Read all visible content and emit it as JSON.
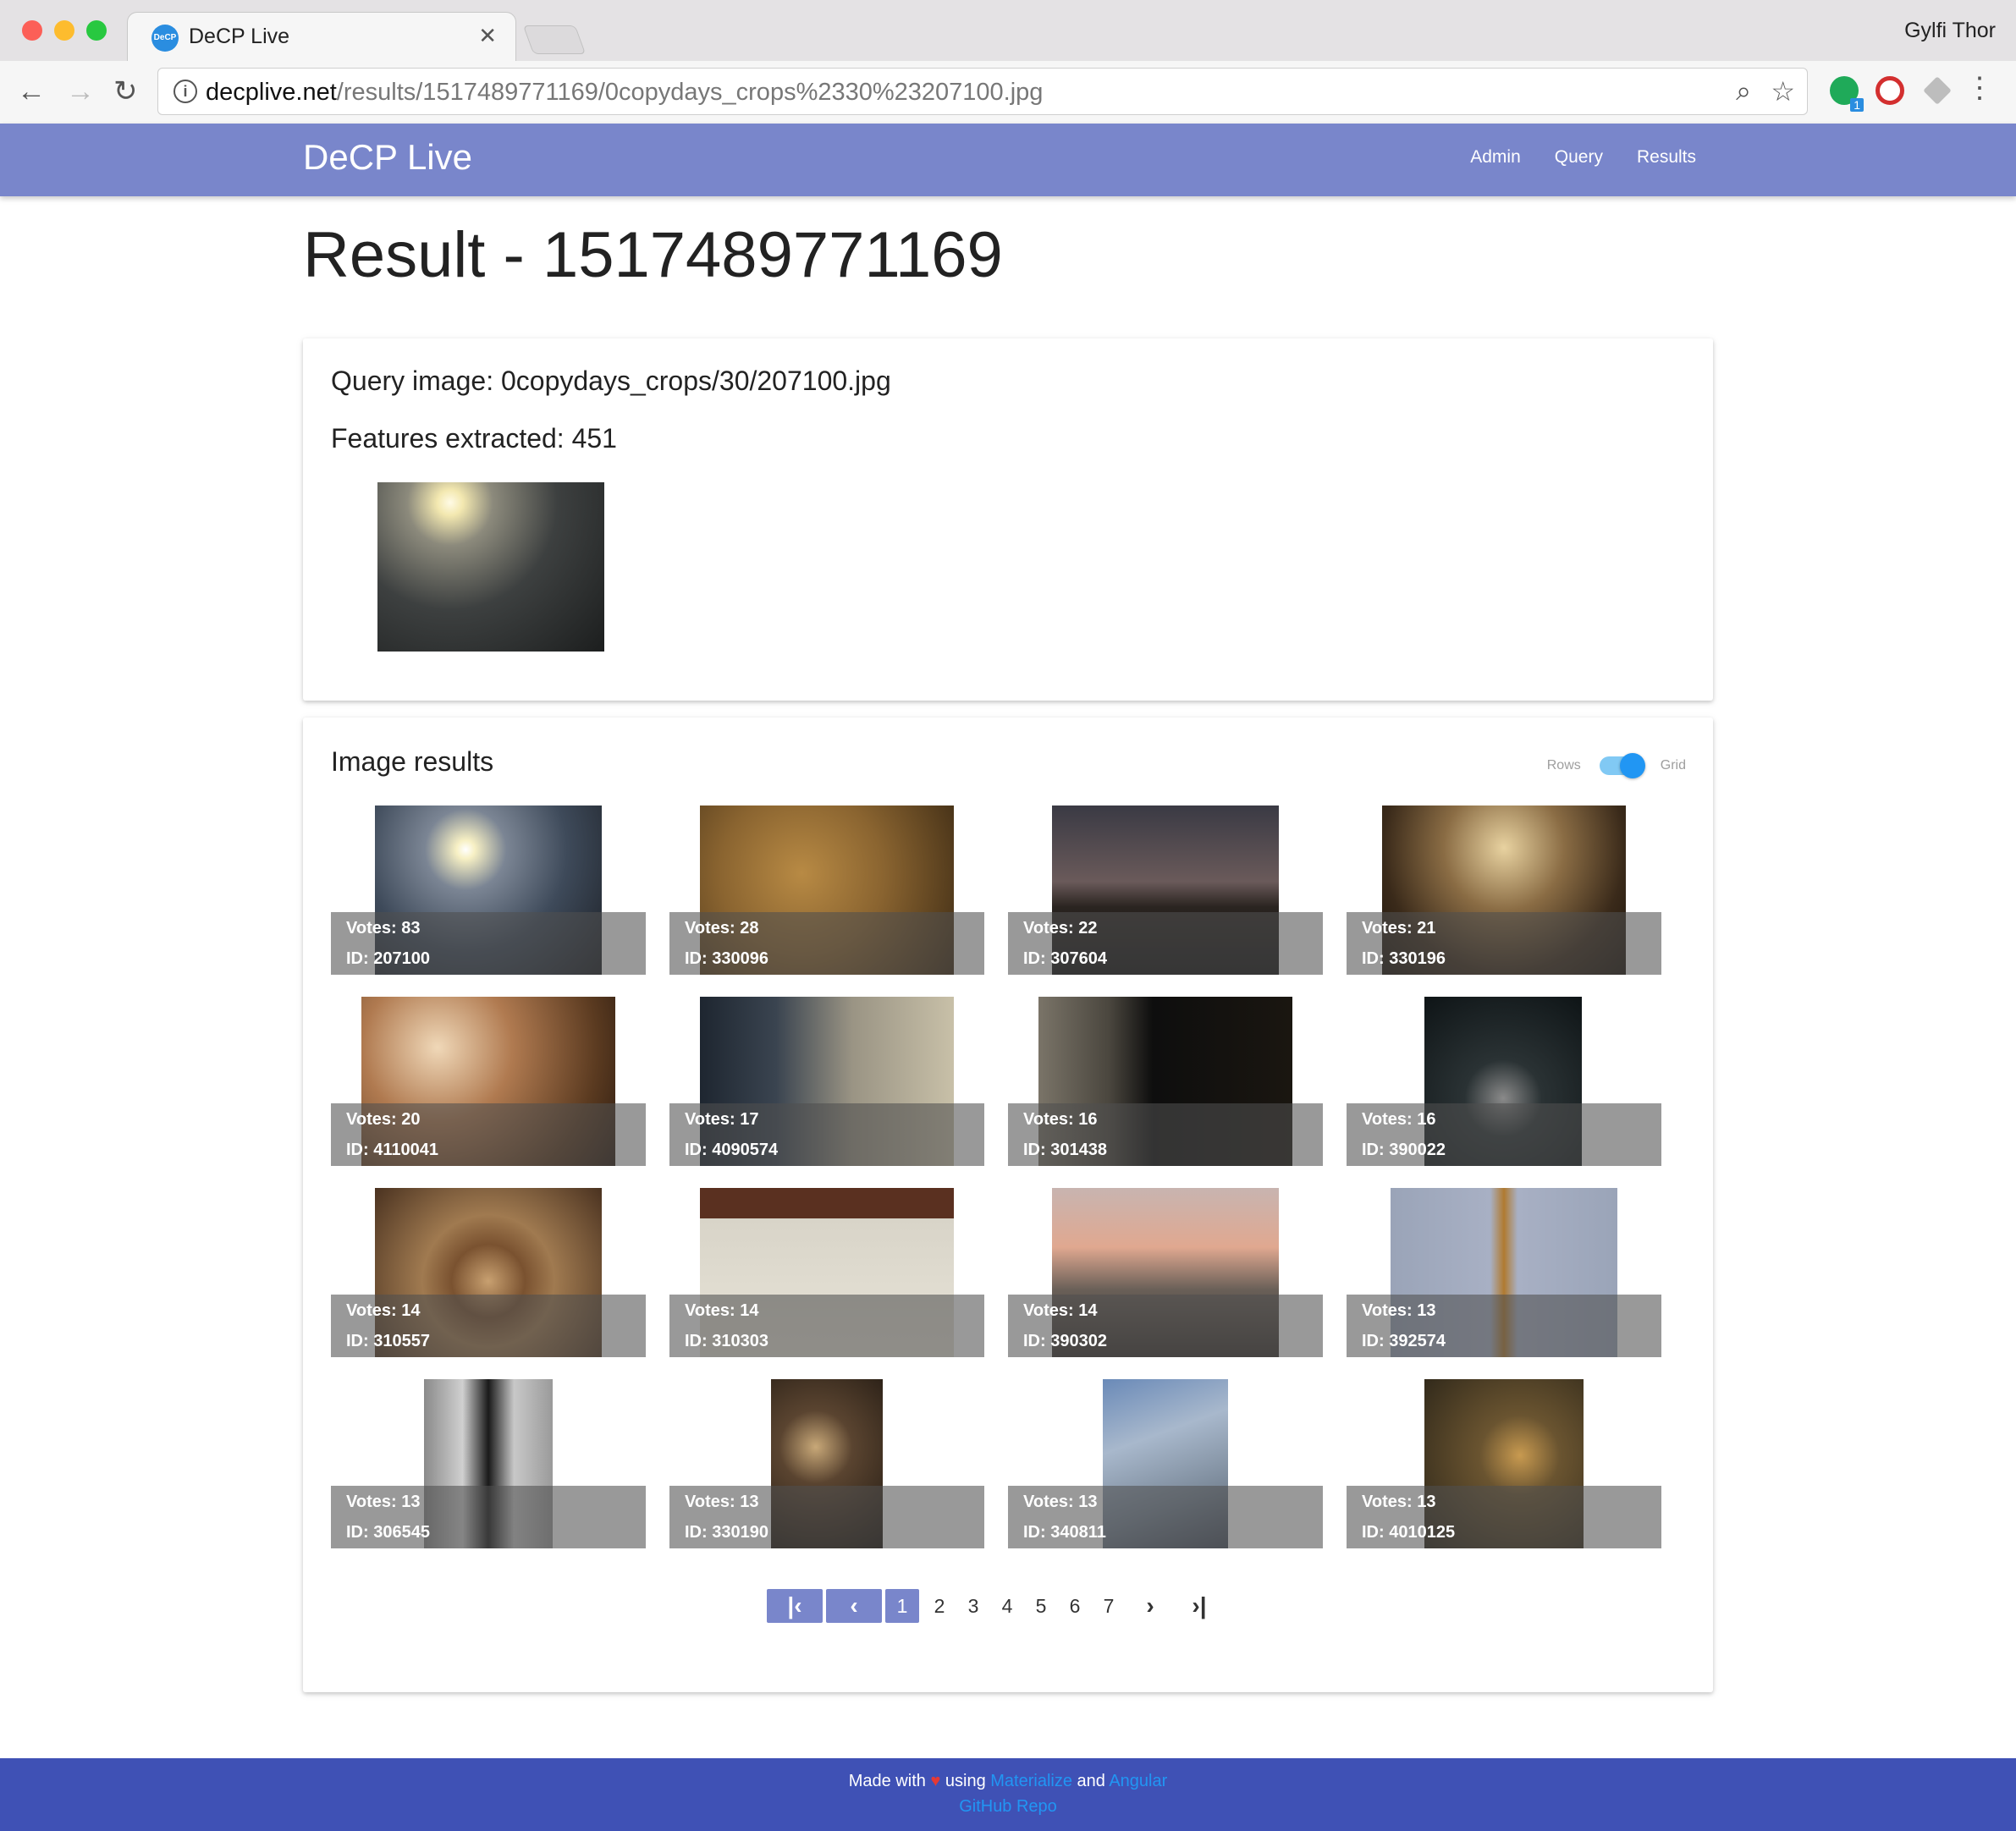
{
  "browser": {
    "tab_title": "DeCP Live",
    "tab_favicon_text": "DeCP",
    "user_name": "Gylfi Thor",
    "url_host": "decplive.net",
    "url_path": "/results/1517489771169/0copydays_crops%2330%23207100.jpg",
    "extension_badge": "1"
  },
  "navbar": {
    "brand": "DeCP Live",
    "links": [
      "Admin",
      "Query",
      "Results"
    ]
  },
  "page": {
    "title": "Result - 1517489771169"
  },
  "query_card": {
    "query_image_label": "Query image: 0copydays_crops/30/207100.jpg",
    "features_label": "Features extracted: 451"
  },
  "results_card": {
    "title": "Image results",
    "toggle_left": "Rows",
    "toggle_right": "Grid",
    "toggle_state": "Grid",
    "results": [
      {
        "votes": "Votes: 83",
        "id": "ID: 207100"
      },
      {
        "votes": "Votes: 28",
        "id": "ID: 330096"
      },
      {
        "votes": "Votes: 22",
        "id": "ID: 307604"
      },
      {
        "votes": "Votes: 21",
        "id": "ID: 330196"
      },
      {
        "votes": "Votes: 20",
        "id": "ID: 4110041"
      },
      {
        "votes": "Votes: 17",
        "id": "ID: 4090574"
      },
      {
        "votes": "Votes: 16",
        "id": "ID: 301438"
      },
      {
        "votes": "Votes: 16",
        "id": "ID: 390022"
      },
      {
        "votes": "Votes: 14",
        "id": "ID: 310557"
      },
      {
        "votes": "Votes: 14",
        "id": "ID: 310303"
      },
      {
        "votes": "Votes: 14",
        "id": "ID: 390302"
      },
      {
        "votes": "Votes: 13",
        "id": "ID: 392574"
      },
      {
        "votes": "Votes: 13",
        "id": "ID: 306545"
      },
      {
        "votes": "Votes: 13",
        "id": "ID: 330190"
      },
      {
        "votes": "Votes: 13",
        "id": "ID: 340811"
      },
      {
        "votes": "Votes: 13",
        "id": "ID: 4010125"
      }
    ],
    "pagination": {
      "current": "1",
      "pages": [
        "2",
        "3",
        "4",
        "5",
        "6",
        "7"
      ]
    }
  },
  "footer": {
    "made_with": "Made with",
    "using": "using",
    "materialize": "Materialize",
    "and": "and",
    "angular": "Angular",
    "github": "GitHub Repo"
  },
  "colors": {
    "navbar": "#7986cb",
    "footer": "#3f51b5",
    "link": "#2196f3",
    "toggle": "#2196f3"
  }
}
